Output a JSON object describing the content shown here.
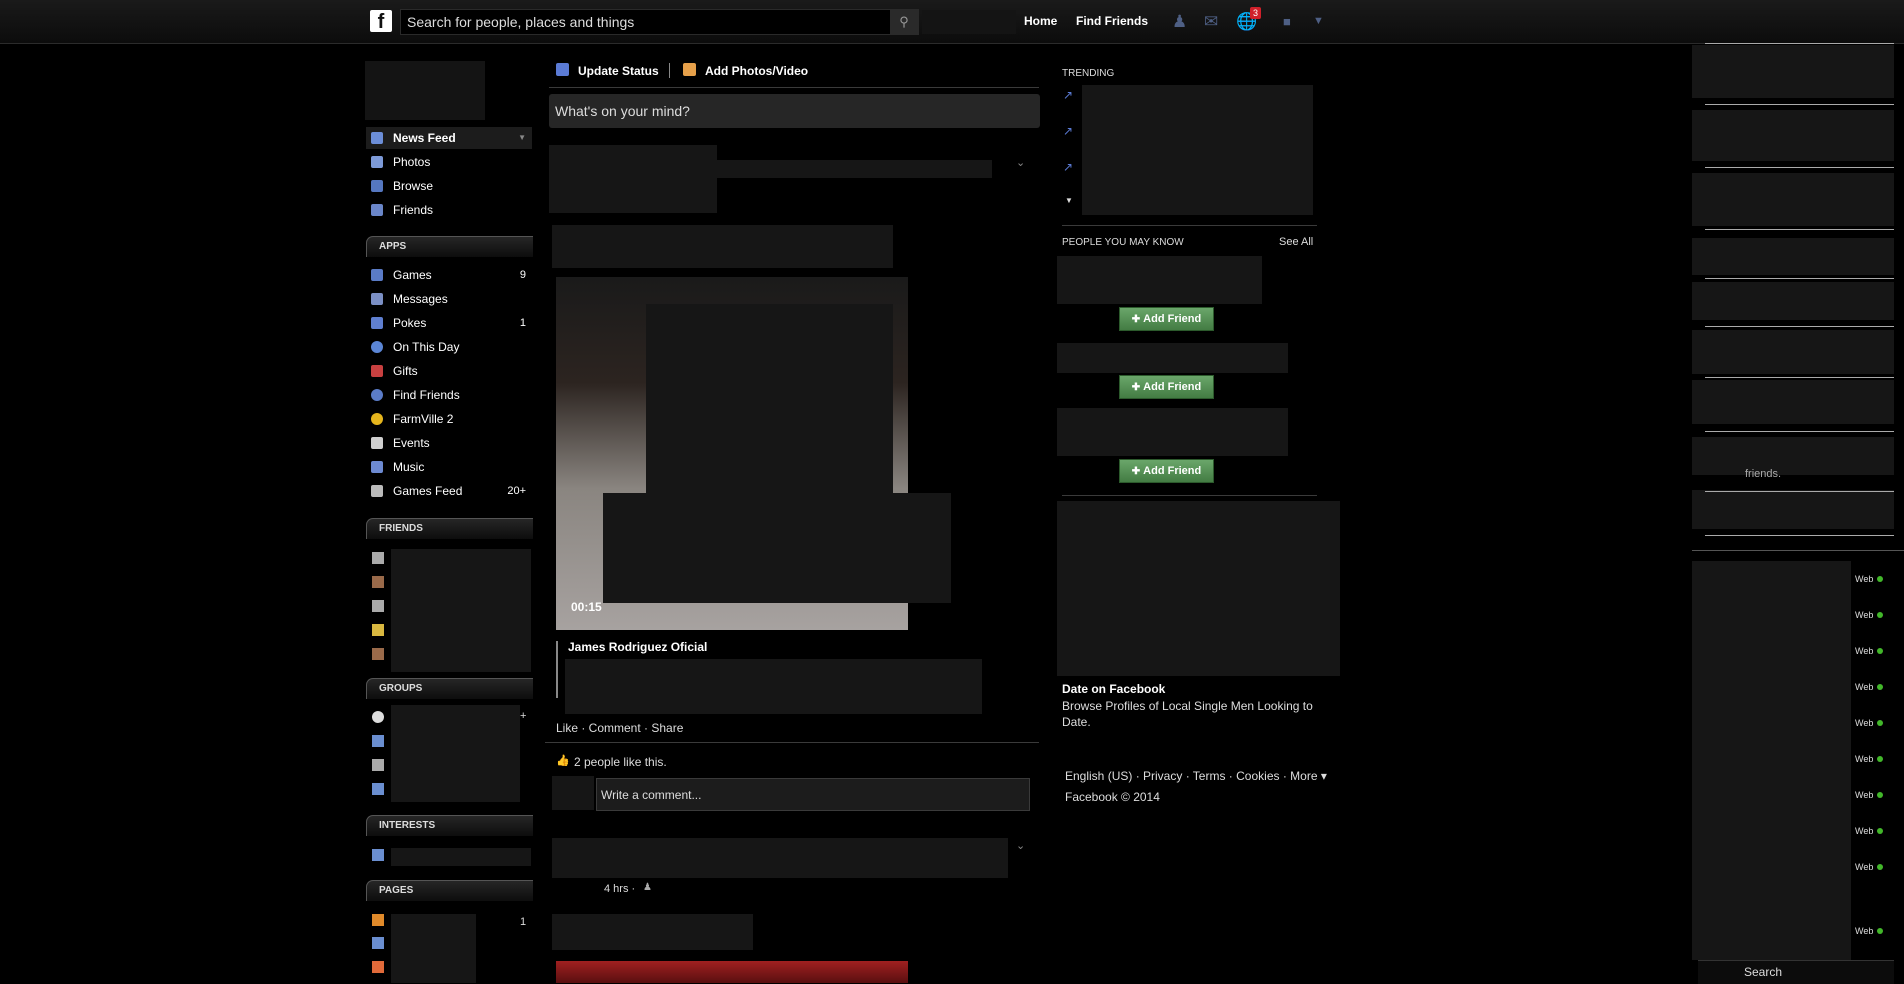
{
  "topbar": {
    "logo": "f",
    "search_placeholder": "Search for people, places and things",
    "search_icon": "search-icon",
    "nav": [
      "Home",
      "Find Friends"
    ],
    "notifications_count": "3",
    "icons": [
      "friend-requests-icon",
      "messages-icon",
      "notifications-icon",
      "privacy-icon",
      "account-menu-icon"
    ]
  },
  "left_nav": {
    "main": [
      {
        "label": "News Feed",
        "icon": "news-feed-icon"
      },
      {
        "label": "Photos",
        "icon": "photos-icon"
      },
      {
        "label": "Browse",
        "icon": "browse-icon"
      },
      {
        "label": "Friends",
        "icon": "friends-icon"
      }
    ],
    "apps_header": "APPS",
    "apps": [
      {
        "label": "Games",
        "count": "9",
        "icon": "games-icon"
      },
      {
        "label": "Messages",
        "count": "",
        "icon": "messages-icon"
      },
      {
        "label": "Pokes",
        "count": "1",
        "icon": "pokes-icon"
      },
      {
        "label": "On This Day",
        "count": "",
        "icon": "on-this-day-icon"
      },
      {
        "label": "Gifts",
        "count": "",
        "icon": "gifts-icon"
      },
      {
        "label": "Find Friends",
        "count": "",
        "icon": "find-friends-icon"
      },
      {
        "label": "FarmVille 2",
        "count": "",
        "icon": "farmville-icon"
      },
      {
        "label": "Events",
        "count": "",
        "icon": "events-icon"
      },
      {
        "label": "Music",
        "count": "",
        "icon": "music-icon"
      },
      {
        "label": "Games Feed",
        "count": "20+",
        "icon": "games-feed-icon"
      }
    ],
    "friends_header": "FRIENDS",
    "groups_header": "GROUPS",
    "groups_plus": "+",
    "interests_header": "INTERESTS",
    "pages_header": "PAGES",
    "pages_count": "1"
  },
  "composer": {
    "update_status": "Update Status",
    "add_photos": "Add Photos/Video",
    "placeholder": "What's on your mind?"
  },
  "post1": {
    "video_duration": "00:15",
    "page_name": "James Rodriguez Oficial",
    "actions": "Like · Comment · Share",
    "likes": "2 people like this.",
    "comment_placeholder": "Write a comment..."
  },
  "post2": {
    "time": "4 hrs ·"
  },
  "right_col": {
    "trending_header": "TRENDING",
    "pymk_header": "PEOPLE YOU MAY KNOW",
    "see_all": "See All",
    "add_friend": "Add Friend",
    "ad_title": "Date on Facebook",
    "ad_body": "Browse Profiles of Local Single Men Looking to Date.",
    "footer_links": "English (US) · Privacy · Terms · Cookies · More ▾",
    "copyright": "Facebook © 2014"
  },
  "sidebar_chat": {
    "fragment_text": "friends.",
    "status_label": "Web",
    "search_label": "Search"
  }
}
